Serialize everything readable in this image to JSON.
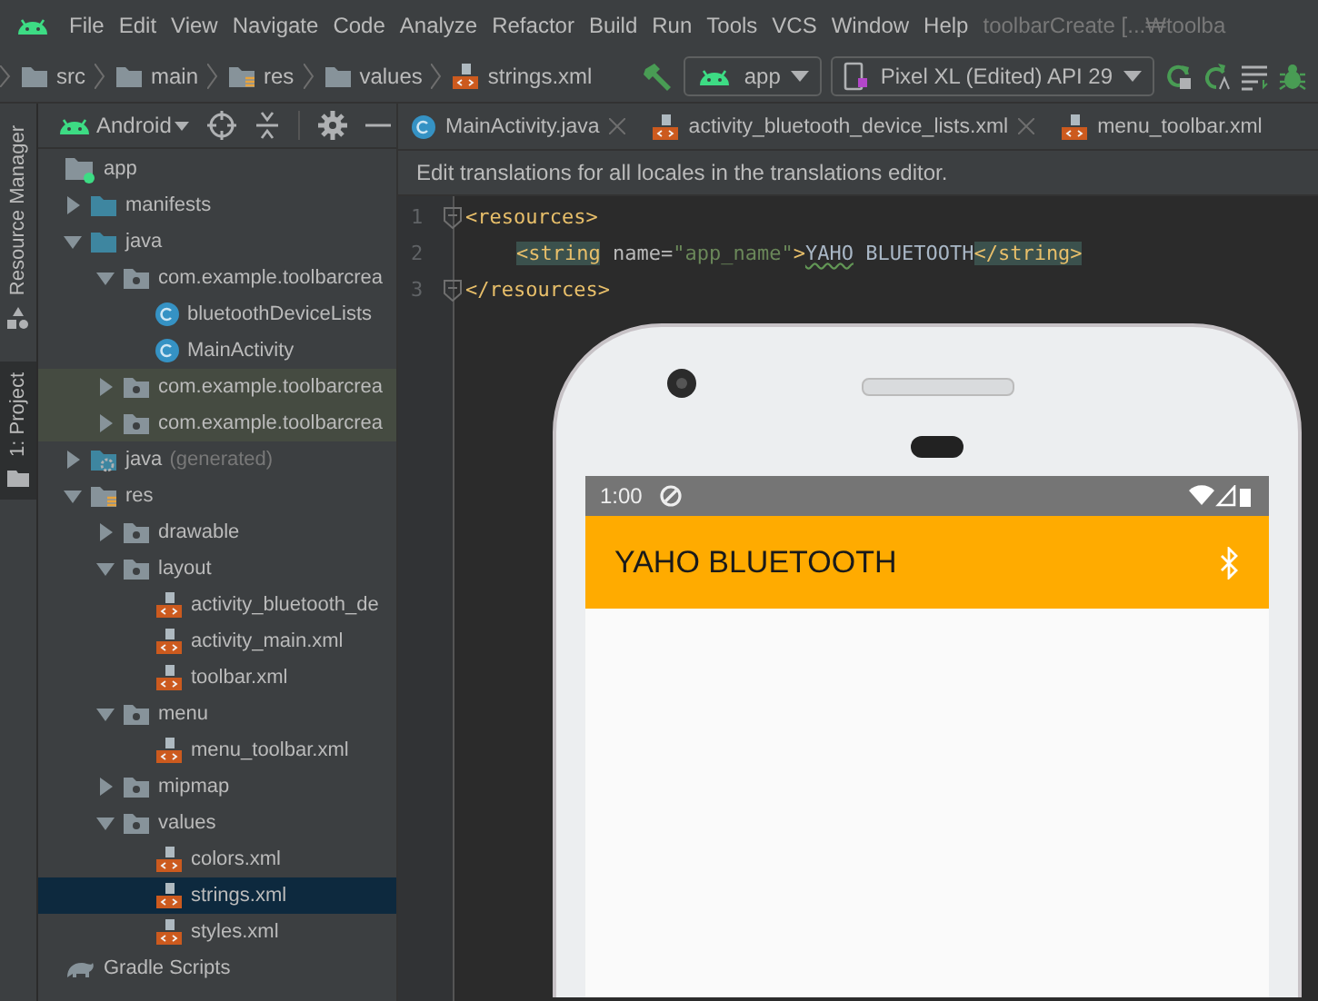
{
  "menu_bar": {
    "items": [
      "File",
      "Edit",
      "View",
      "Navigate",
      "Code",
      "Analyze",
      "Refactor",
      "Build",
      "Run",
      "Tools",
      "VCS",
      "Window",
      "Help"
    ],
    "title": "toolbarCreate [...₩toolba"
  },
  "breadcrumbs": [
    {
      "label": "src",
      "kind": "folder"
    },
    {
      "label": "main",
      "kind": "folder"
    },
    {
      "label": "res",
      "kind": "res"
    },
    {
      "label": "values",
      "kind": "folder"
    },
    {
      "label": "strings.xml",
      "kind": "xml"
    }
  ],
  "run_config": {
    "module": "app",
    "device": "Pixel XL (Edited) API 29"
  },
  "side_strip": [
    {
      "label": "Resource Manager",
      "selected": false
    },
    {
      "label": "1: Project",
      "selected": true
    }
  ],
  "project_panel": {
    "view": "Android",
    "tree": [
      {
        "label": "app",
        "kind": "module",
        "children": [
          {
            "label": "manifests",
            "kind": "folder",
            "expanded": false
          },
          {
            "label": "java",
            "kind": "folder",
            "expanded": true,
            "children": [
              {
                "label": "com.example.toolbarcrea",
                "kind": "package",
                "expanded": true,
                "children": [
                  {
                    "label": "bluetoothDeviceLists",
                    "kind": "class"
                  },
                  {
                    "label": "MainActivity",
                    "kind": "class"
                  }
                ]
              },
              {
                "label": "com.example.toolbarcrea",
                "kind": "package",
                "expanded": false,
                "highlighted": true
              },
              {
                "label": "com.example.toolbarcrea",
                "kind": "package",
                "expanded": false,
                "highlighted": true
              }
            ]
          },
          {
            "label": "java",
            "note": "(generated)",
            "kind": "generated",
            "expanded": false
          },
          {
            "label": "res",
            "kind": "res",
            "expanded": true,
            "children": [
              {
                "label": "drawable",
                "kind": "package",
                "expanded": false
              },
              {
                "label": "layout",
                "kind": "package",
                "expanded": true,
                "children": [
                  {
                    "label": "activity_bluetooth_de",
                    "kind": "xml"
                  },
                  {
                    "label": "activity_main.xml",
                    "kind": "xml"
                  },
                  {
                    "label": "toolbar.xml",
                    "kind": "xml"
                  }
                ]
              },
              {
                "label": "menu",
                "kind": "package",
                "expanded": true,
                "children": [
                  {
                    "label": "menu_toolbar.xml",
                    "kind": "xml"
                  }
                ]
              },
              {
                "label": "mipmap",
                "kind": "package",
                "expanded": false
              },
              {
                "label": "values",
                "kind": "package",
                "expanded": true,
                "children": [
                  {
                    "label": "colors.xml",
                    "kind": "xml"
                  },
                  {
                    "label": "strings.xml",
                    "kind": "xml",
                    "selected": true
                  },
                  {
                    "label": "styles.xml",
                    "kind": "xml"
                  }
                ]
              }
            ]
          }
        ]
      },
      {
        "label": "Gradle Scripts",
        "kind": "gradle"
      }
    ]
  },
  "editor_tabs": [
    {
      "label": "MainActivity.java",
      "kind": "class",
      "selected": false
    },
    {
      "label": "activity_bluetooth_device_lists.xml",
      "kind": "xml",
      "selected": false
    },
    {
      "label": "menu_toolbar.xml",
      "kind": "xml",
      "selected": false
    }
  ],
  "notification": "Edit translations for all locales in the translations editor.",
  "code": [
    {
      "number": "1",
      "tokens": [
        {
          "kind": "tag",
          "text": "<resources>"
        }
      ]
    },
    {
      "number": "2",
      "indent": true,
      "tokens": [
        {
          "kind": "tag-match",
          "text": "<string"
        },
        {
          "kind": "attr",
          "text": " name="
        },
        {
          "kind": "value",
          "text": "\"app_name\""
        },
        {
          "kind": "tag",
          "text": ">"
        },
        {
          "kind": "typo",
          "text": "YAHO"
        },
        {
          "kind": "plain",
          "text": " BLUETOOTH"
        },
        {
          "kind": "tag-match",
          "text": "</string>"
        }
      ]
    },
    {
      "number": "3",
      "tokens": [
        {
          "kind": "tag",
          "text": "</resources>"
        }
      ]
    }
  ],
  "preview": {
    "time": "1:00",
    "app_title": "YAHO BLUETOOTH"
  }
}
